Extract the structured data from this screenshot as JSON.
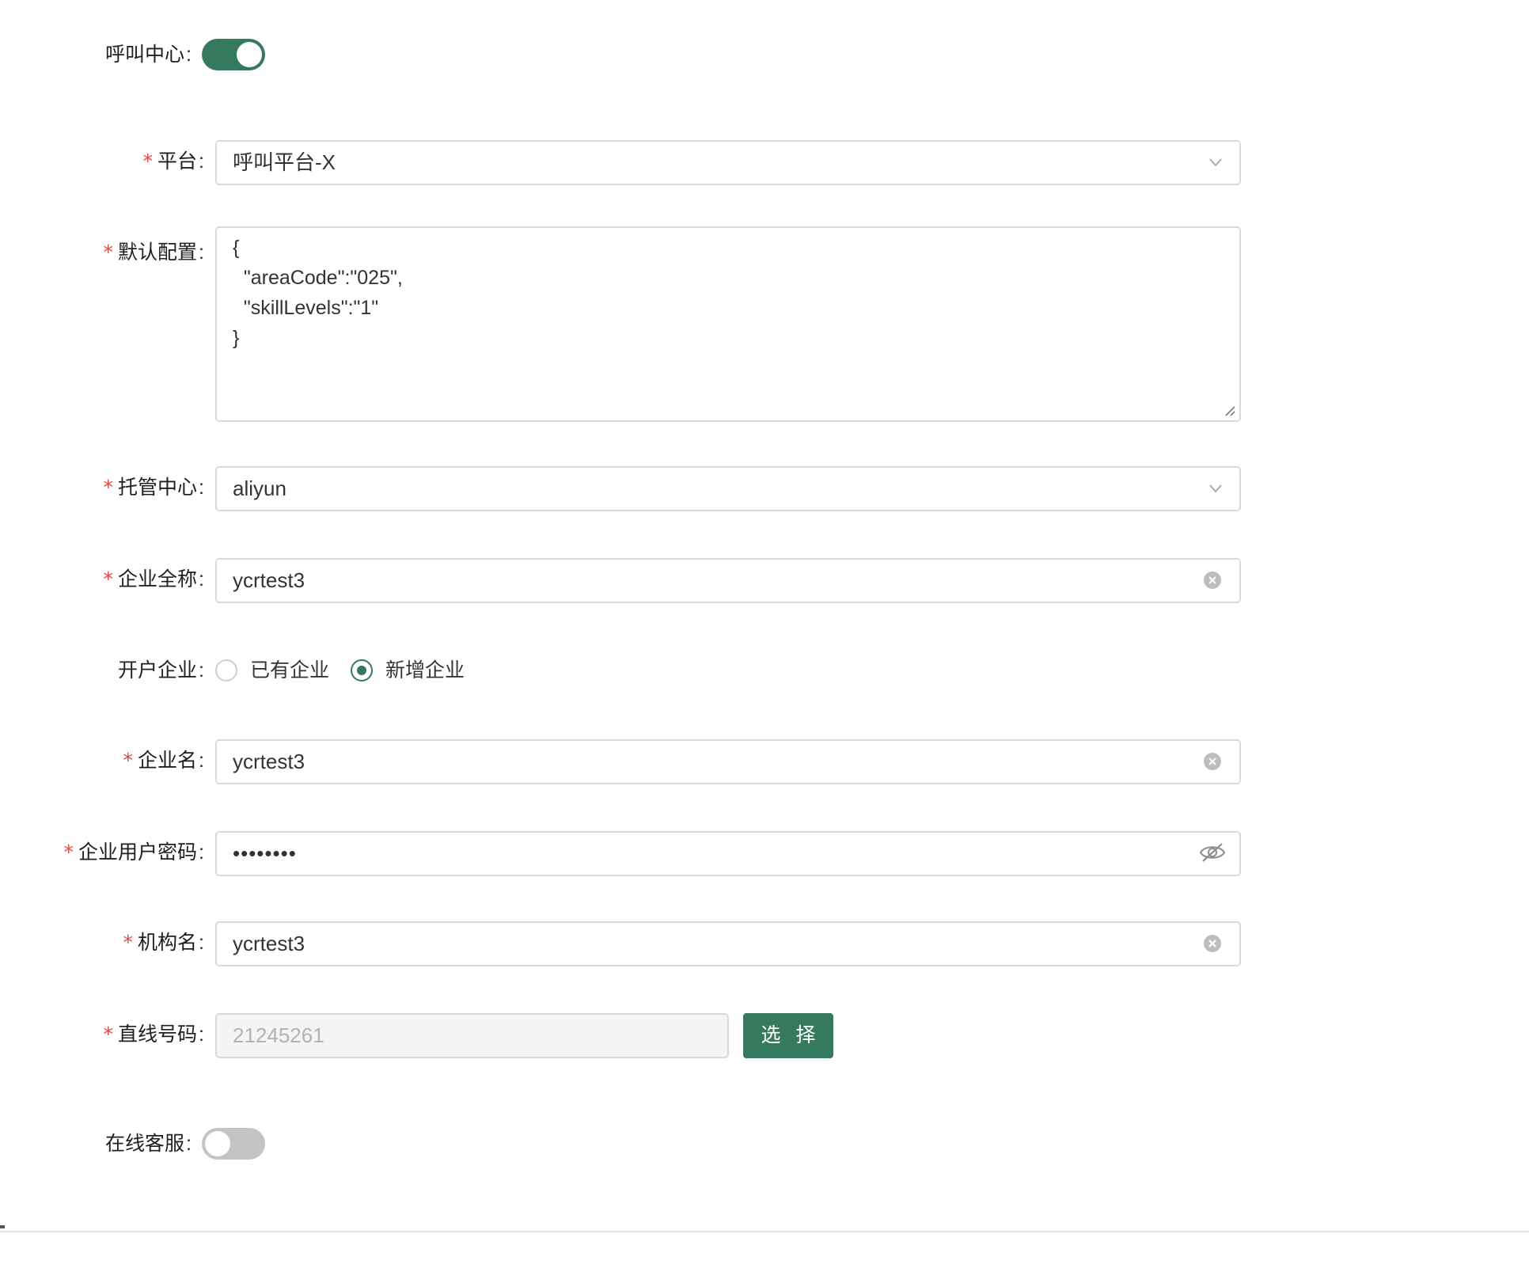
{
  "call_center": {
    "label": "呼叫中心",
    "enabled": true
  },
  "platform": {
    "label": "平台",
    "required": true,
    "value": "呼叫平台-X"
  },
  "default_config": {
    "label": "默认配置",
    "required": true,
    "lines": [
      "{",
      "  \"areaCode\":\"025\",",
      "  \"skillLevels\":\"1\"",
      "}"
    ]
  },
  "hosting_center": {
    "label": "托管中心",
    "required": true,
    "value": "aliyun"
  },
  "company_full_name": {
    "label": "企业全称",
    "required": true,
    "value": "ycrtest3"
  },
  "open_account_company": {
    "label": "开户企业",
    "options": [
      {
        "label": "已有企业",
        "checked": false
      },
      {
        "label": "新增企业",
        "checked": true
      }
    ]
  },
  "company_name": {
    "label": "企业名",
    "required": true,
    "value": "ycrtest3"
  },
  "company_user_password": {
    "label": "企业用户密码",
    "required": true,
    "value": "••••••••"
  },
  "org_name": {
    "label": "机构名",
    "required": true,
    "value": "ycrtest3"
  },
  "direct_number": {
    "label": "直线号码",
    "required": true,
    "value": "21245261",
    "button_label": "选 择"
  },
  "online_service": {
    "label": "在线客服",
    "enabled": false
  },
  "common": {
    "required_mark": "*",
    "colon": ":"
  },
  "colors": {
    "accent": "#357a5f",
    "required": "#e2483d",
    "border": "#d9d9d9"
  }
}
